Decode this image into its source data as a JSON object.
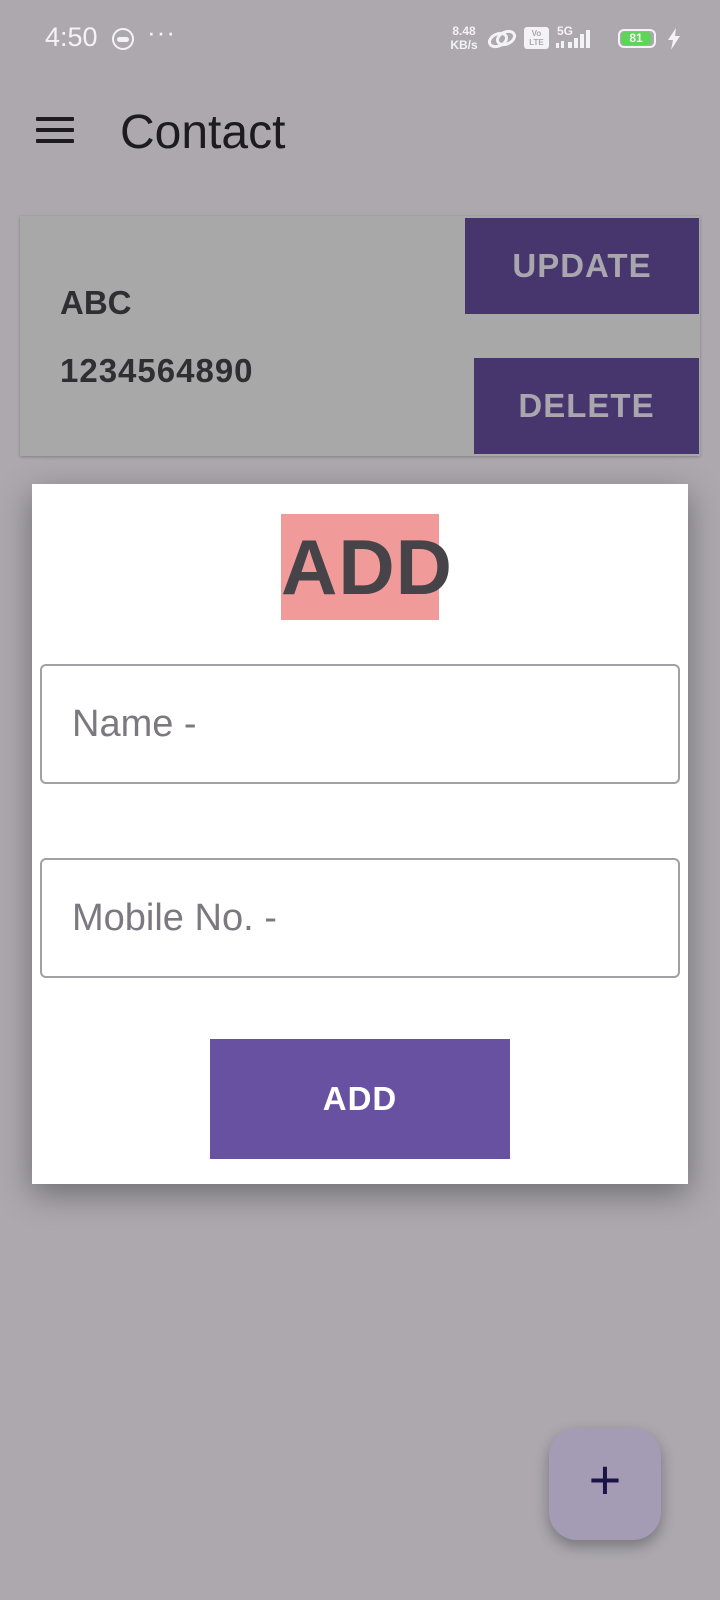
{
  "status_bar": {
    "time": "4:50",
    "overflow_dots": "···",
    "network_speed_value": "8.48",
    "network_speed_unit": "KB/s",
    "volte_label": "Vo LTE",
    "network_type": "5G",
    "battery_level": "81"
  },
  "app_bar": {
    "title": "Contact",
    "menu_icon": "hamburger-menu-icon"
  },
  "contacts": [
    {
      "name": "ABC",
      "number": "1234564890",
      "update_label": "UPDATE",
      "delete_label": "DELETE"
    }
  ],
  "dialog": {
    "title": "ADD",
    "name_placeholder": "Name -",
    "name_value": "",
    "mobile_placeholder": "Mobile No. -",
    "mobile_value": "",
    "add_button_label": "ADD"
  },
  "fab": {
    "icon": "plus-icon",
    "glyph": "+"
  },
  "colors": {
    "scrim_background": "#aca8ae",
    "card_background": "#a8a8a8",
    "card_button": "#46366d",
    "dialog_title_highlight": "#f09a9a",
    "primary_button": "#6951a2",
    "fab_background": "#a39cb4",
    "battery_fill": "#5fd35a"
  }
}
